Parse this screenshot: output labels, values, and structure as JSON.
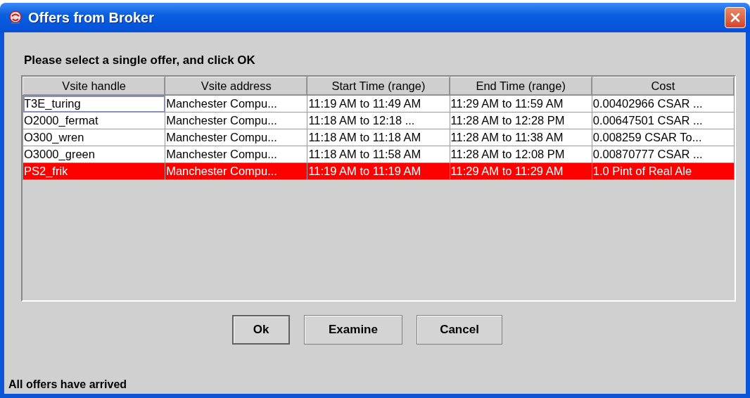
{
  "window": {
    "title": "Offers from Broker"
  },
  "instruction": "Please select a single offer, and click OK",
  "table": {
    "columns": [
      "Vsite handle",
      "Vsite address",
      "Start Time (range)",
      "End Time (range)",
      "Cost"
    ],
    "rows": [
      {
        "selected": false,
        "focused": true,
        "cells": [
          "T3E_turing",
          "Manchester Compu...",
          "11:19 AM to 11:49 AM",
          "11:29 AM to 11:59 AM",
          "0.00402966 CSAR ..."
        ]
      },
      {
        "selected": false,
        "focused": false,
        "cells": [
          "O2000_fermat",
          "Manchester Compu...",
          "11:18 AM to 12:18 ...",
          "11:28 AM to 12:28 PM",
          "0.00647501 CSAR ..."
        ]
      },
      {
        "selected": false,
        "focused": false,
        "cells": [
          "O300_wren",
          "Manchester Compu...",
          "11:18 AM to 11:18 AM",
          "11:28 AM to 11:38 AM",
          "0.008259 CSAR To..."
        ]
      },
      {
        "selected": false,
        "focused": false,
        "cells": [
          "O3000_green",
          "Manchester Compu...",
          "11:18 AM to 11:58 AM",
          "11:28 AM to 12:08 PM",
          "0.00870777 CSAR ..."
        ]
      },
      {
        "selected": true,
        "focused": false,
        "cells": [
          "PS2_frik",
          "Manchester Compu...",
          "11:19 AM to 11:19 AM",
          "11:29 AM to 11:29 AM",
          "1.0 Pint of Real Ale"
        ]
      }
    ]
  },
  "buttons": [
    {
      "label": "Ok",
      "default": true
    },
    {
      "label": "Examine",
      "default": false
    },
    {
      "label": "Cancel",
      "default": false
    }
  ],
  "status_bar": "All offers have arrived"
}
